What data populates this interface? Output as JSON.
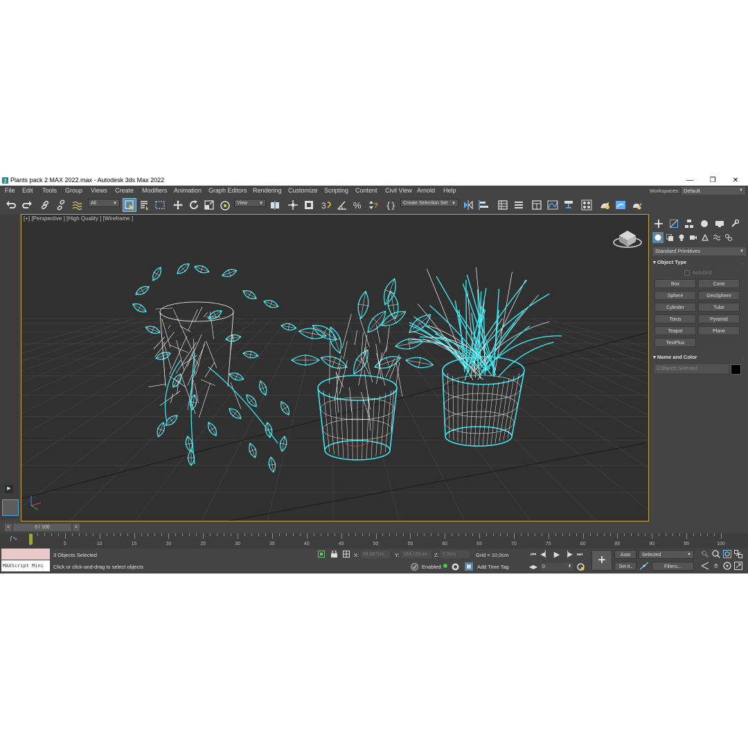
{
  "window": {
    "title": "Plants pack 2 MAX 2022.max - Autodesk 3ds Max 2022",
    "minimize": "—",
    "maximize": "❐",
    "close": "✕"
  },
  "menu": {
    "items": [
      "File",
      "Edit",
      "Tools",
      "Group",
      "Views",
      "Create",
      "Modifiers",
      "Animation",
      "Graph Editors",
      "Rendering",
      "Customize",
      "Scripting",
      "Content",
      "Civil View",
      "Arnold",
      "Help"
    ],
    "workspaces_label": "Workspaces:",
    "workspaces_value": "Default"
  },
  "toolbar": {
    "selection_filter": "All",
    "reference_coord": "View",
    "selection_set": "Create Selection Set"
  },
  "viewport": {
    "label": "[+] [Perspective ] [High Quality ] [Wireframe ]",
    "wire_selected_color": "#39e6ef",
    "wire_inner_color": "#ffffff",
    "background": "#303030"
  },
  "command_panel": {
    "category": "Standard Primitives",
    "object_type_title": "Object Type",
    "autogrid": "AutoGrid",
    "primitives": [
      "Box",
      "Cone",
      "Sphere",
      "GeoSphere",
      "Cylinder",
      "Tube",
      "Torus",
      "Pyramid",
      "Teapot",
      "Plane",
      "TextPlus"
    ],
    "name_color_title": "Name and Color",
    "name_value": "3 Objects Selected"
  },
  "timeline": {
    "slider": "0 / 100",
    "ticks": [
      "0",
      "5",
      "10",
      "15",
      "20",
      "25",
      "30",
      "35",
      "40",
      "45",
      "50",
      "55",
      "60",
      "65",
      "70",
      "75",
      "80",
      "85",
      "90",
      "95",
      "100"
    ]
  },
  "status": {
    "maxscript": "MAXScript Mini",
    "selected": "3 Objects Selected",
    "prompt": "Click or click-and-drag to select objects",
    "x_label": "X:",
    "x_value": "66,967cm",
    "y_label": "Y:",
    "y_value": "164,185cm",
    "z_label": "Z:",
    "z_value": "0,0cm",
    "grid": "Grid = 10,0cm",
    "enabled": "Enabled:",
    "add_time_tag": "Add Time Tag",
    "auto": "Auto",
    "set_key": "Set K.",
    "key_filter": "Selected",
    "filters": "Filters...",
    "frame": "0"
  }
}
